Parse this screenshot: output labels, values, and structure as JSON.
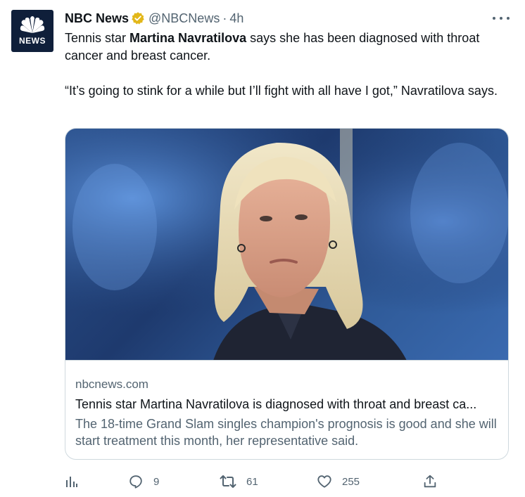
{
  "account": {
    "name": "NBC News",
    "handle": "@NBCNews",
    "separator": "·",
    "time": "4h",
    "avatar_text": "NEWS",
    "verified_color": "#e2b719"
  },
  "tweet": {
    "line1_pre": "Tennis star ",
    "line1_bold": "Martina Navratilova",
    "line1_post": " says she has been diagnosed with throat cancer and breast cancer.",
    "line2": "“It’s going to stink for a while but I’ll fight with all have I got,” Navratilova says."
  },
  "card": {
    "domain": "nbcnews.com",
    "title": "Tennis star Martina Navratilova is diagnosed with throat and breast ca...",
    "description": "The 18-time Grand Slam singles champion's prognosis is good and she will start treatment this month, her representative said."
  },
  "actions": {
    "views_icon": "analytics-icon",
    "reply_count": "9",
    "retweet_count": "61",
    "like_count": "255",
    "share_icon": "share-icon"
  },
  "colors": {
    "text": "#0f1419",
    "muted": "#536471",
    "border": "#cfd9de"
  }
}
